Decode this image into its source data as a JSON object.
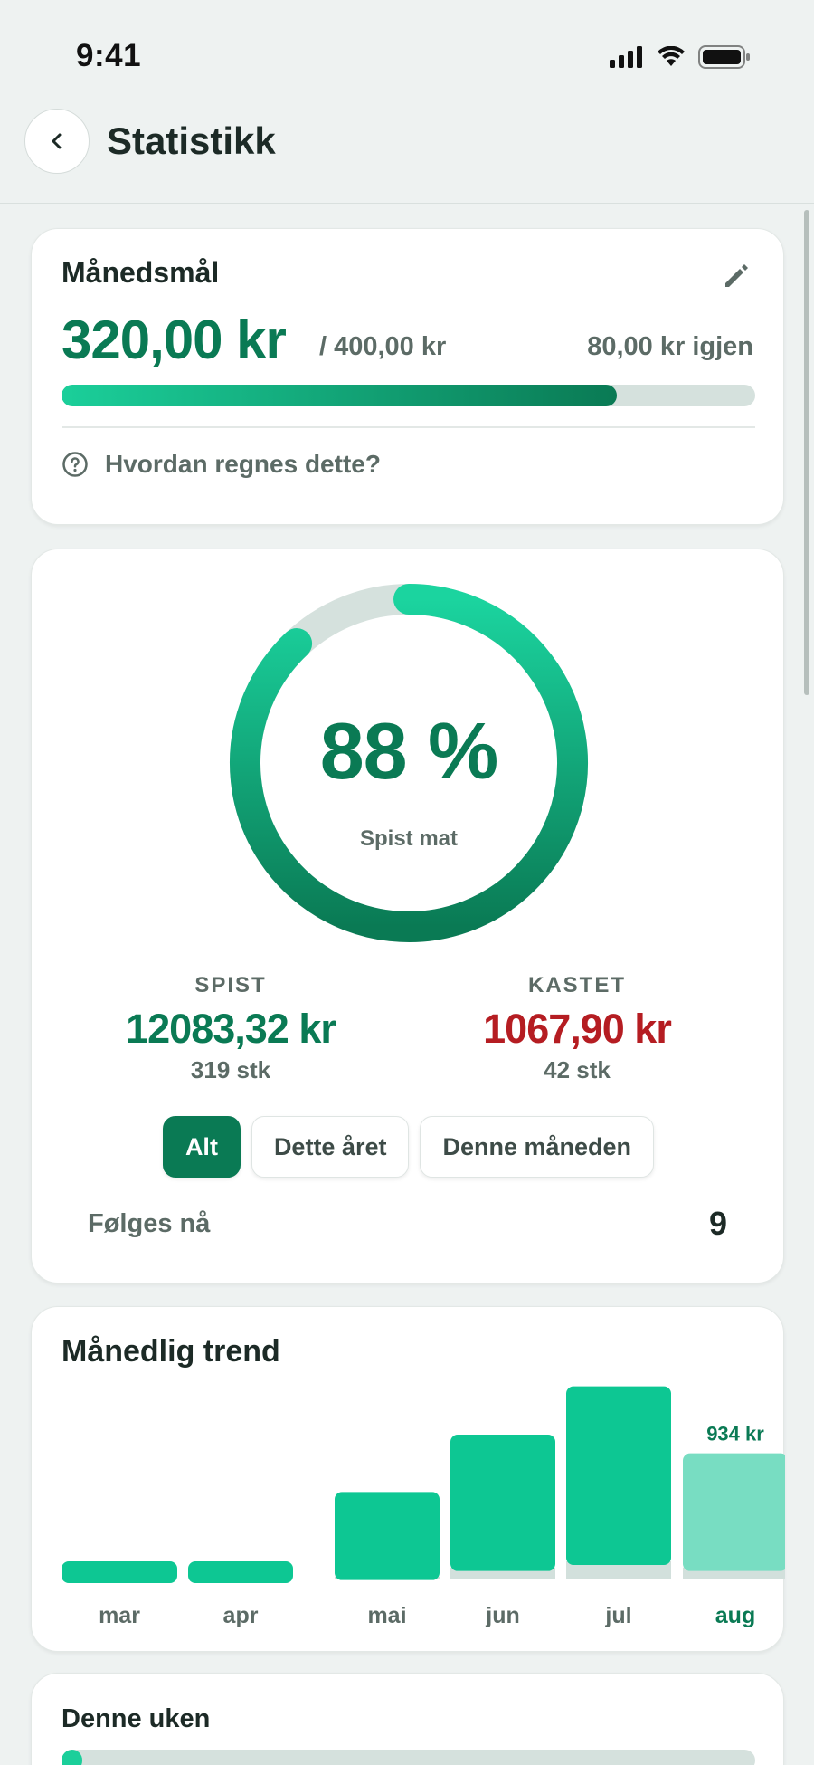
{
  "status_bar": {
    "time": "9:41"
  },
  "header": {
    "title": "Statistikk"
  },
  "goal": {
    "title": "Månedsmål",
    "amount": "320,00 kr",
    "total": "/ 400,00 kr",
    "remaining": "80,00 kr igjen",
    "progress_fraction": 0.8,
    "help_text": "Hvordan regnes dette?"
  },
  "stats": {
    "ring_value": "88 %",
    "ring_fraction": 0.88,
    "ring_label": "Spist mat",
    "eaten": {
      "label": "SPIST",
      "amount": "12083,32 kr",
      "count": "319 stk"
    },
    "wasted": {
      "label": "KASTET",
      "amount": "1067,90 kr",
      "count": "42 stk"
    },
    "filters": [
      {
        "label": "Alt",
        "active": true
      },
      {
        "label": "Dette året",
        "active": false
      },
      {
        "label": "Denne måneden",
        "active": false
      }
    ],
    "following_label": "Følges nå",
    "following_count": "9"
  },
  "trend": {
    "title": "Månedlig trend",
    "chart_data": {
      "type": "bar",
      "categories": [
        "mar",
        "apr",
        "mai",
        "jun",
        "jul",
        "aug"
      ],
      "series": [
        {
          "values": [
            60,
            60,
            280,
            440,
            580,
            378
          ]
        },
        {
          "values": [
            0,
            0,
            10,
            40,
            60,
            40
          ]
        }
      ],
      "highlighted_category": "aug",
      "value_labels": {
        "aug": "934 kr"
      },
      "colors": {
        "bar": "#0dc793",
        "bar_light": "#78ddc2",
        "bar_base": "#d2e0dc",
        "accent": "#0a7a54"
      }
    }
  },
  "week": {
    "title": "Denne uken",
    "progress_fraction": 0.03
  },
  "colors": {
    "primary": "#0a7a54",
    "accent": "#1bcf9a",
    "danger": "#b51d22",
    "muted": "#5c6b66"
  }
}
